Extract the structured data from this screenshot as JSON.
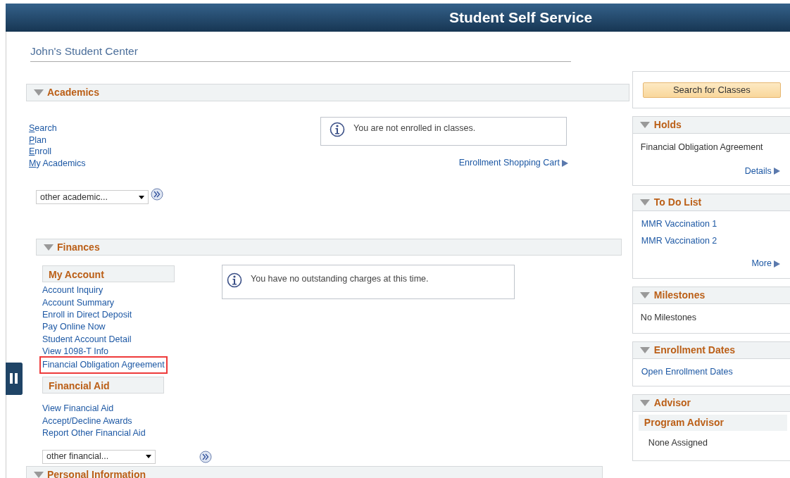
{
  "header": {
    "title": "Student Self Service"
  },
  "page_title": "John's Student Center",
  "academics": {
    "title": "Academics",
    "expanded": true,
    "links": [
      "Search",
      "Plan",
      "Enroll",
      "My Academics"
    ],
    "notice": "You are not enrolled in classes.",
    "cart_link": "Enrollment Shopping Cart",
    "dropdown": {
      "value": "other academic..."
    }
  },
  "finances": {
    "title": "Finances",
    "expanded": true,
    "groups": [
      {
        "title": "My Account",
        "links": [
          {
            "label": "Account Inquiry",
            "highlighted": false
          },
          {
            "label": "Account Summary",
            "highlighted": false
          },
          {
            "label": "Enroll in Direct Deposit",
            "highlighted": false
          },
          {
            "label": "Pay Online Now",
            "highlighted": false
          },
          {
            "label": "Student Account Detail",
            "highlighted": false
          },
          {
            "label": "View 1098-T Info",
            "highlighted": false
          },
          {
            "label": "Financial Obligation Agreement",
            "highlighted": true
          }
        ]
      },
      {
        "title": "Financial Aid",
        "links": [
          {
            "label": "View Financial Aid",
            "highlighted": false
          },
          {
            "label": "Accept/Decline Awards",
            "highlighted": false
          },
          {
            "label": "Report Other Financial Aid",
            "highlighted": false
          }
        ]
      }
    ],
    "notice": "You have no outstanding charges at this time.",
    "dropdown": {
      "value": "other financial..."
    }
  },
  "personal_information": {
    "title": "Personal Information",
    "expanded": true
  },
  "sidebar": {
    "search_button": "Search for Classes",
    "panels": [
      {
        "title": "Holds",
        "expanded": true,
        "items": [
          {
            "kind": "text",
            "label": "Financial Obligation Agreement"
          }
        ],
        "more_link": "Details"
      },
      {
        "title": "To Do List",
        "expanded": true,
        "items": [
          {
            "kind": "link",
            "label": "MMR Vaccination 1"
          },
          {
            "kind": "link",
            "label": "MMR Vaccination 2"
          }
        ],
        "more_link": "More"
      },
      {
        "title": "Milestones",
        "expanded": true,
        "items": [
          {
            "kind": "text",
            "label": "No Milestones"
          }
        ]
      },
      {
        "title": "Enrollment Dates",
        "expanded": true,
        "items": [
          {
            "kind": "link",
            "label": "Open Enrollment Dates"
          }
        ]
      },
      {
        "title": "Advisor",
        "expanded": true,
        "items": [
          {
            "kind": "subheading",
            "label": "Program Advisor"
          },
          {
            "kind": "text",
            "label": "None Assigned"
          }
        ]
      }
    ]
  }
}
